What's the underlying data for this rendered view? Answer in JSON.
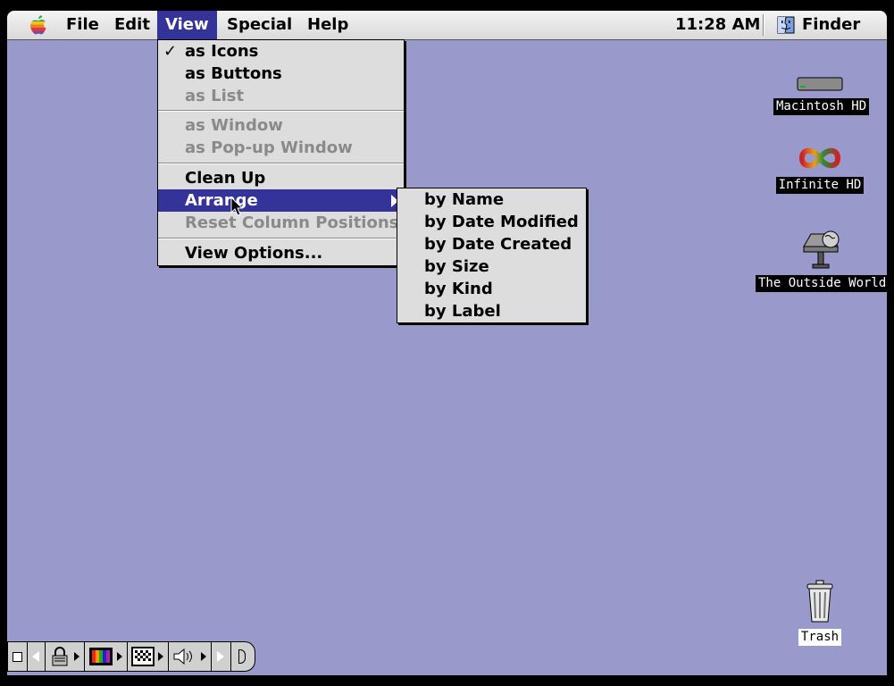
{
  "menubar": {
    "menus": [
      "File",
      "Edit",
      "View",
      "Special",
      "Help"
    ],
    "active_menu": "View",
    "clock": "11:28 AM",
    "app_name": "Finder"
  },
  "view_menu": {
    "items": [
      {
        "label": "as Icons",
        "checked": true,
        "enabled": true
      },
      {
        "label": "as Buttons",
        "enabled": true
      },
      {
        "label": "as List",
        "enabled": false
      },
      {
        "label": "as Window",
        "enabled": false
      },
      {
        "label": "as Pop-up Window",
        "enabled": false
      },
      {
        "label": "Clean Up",
        "enabled": true
      },
      {
        "label": "Arrange",
        "enabled": true,
        "highlighted": true,
        "has_submenu": true
      },
      {
        "label": "Reset Column Positions",
        "enabled": false
      },
      {
        "label": "View Options...",
        "enabled": true
      }
    ],
    "check_mark": "✓"
  },
  "arrange_submenu": {
    "items": [
      "by Name",
      "by Date Modified",
      "by Date Created",
      "by Size",
      "by Kind",
      "by Label"
    ]
  },
  "desktop": {
    "icons": [
      {
        "name": "Macintosh HD",
        "icon": "hard-drive-icon"
      },
      {
        "name": "Infinite HD",
        "icon": "infinite-drive-icon"
      },
      {
        "name": "The Outside World",
        "icon": "network-globe-icon"
      },
      {
        "name": "Trash",
        "icon": "trash-icon"
      }
    ],
    "background_color": "#9999cc"
  },
  "control_strip": {
    "modules": [
      "control-strip-tab-icon",
      "lock-icon",
      "monitor-color-icon",
      "monitor-resolution-icon",
      "speaker-volume-icon",
      "scroll-arrow-icon"
    ]
  },
  "colors": {
    "highlight": "#333399",
    "menu_bg": "#dddddd",
    "disabled_text": "#8a8a8a"
  }
}
